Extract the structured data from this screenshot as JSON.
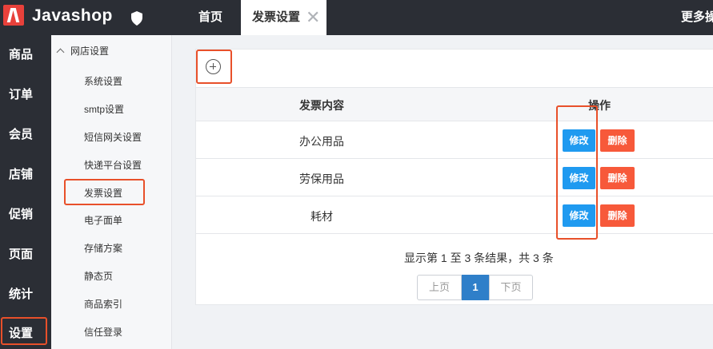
{
  "app": {
    "name": "Javashop"
  },
  "topbar": {
    "tabs": [
      {
        "label": "首页"
      },
      {
        "label": "发票设置",
        "close": "✕"
      }
    ],
    "more": "更多操"
  },
  "leftnav": {
    "items": [
      {
        "label": "商品"
      },
      {
        "label": "订单"
      },
      {
        "label": "会员"
      },
      {
        "label": "店铺"
      },
      {
        "label": "促销"
      },
      {
        "label": "页面"
      },
      {
        "label": "统计"
      },
      {
        "label": "设置"
      }
    ]
  },
  "submenu": {
    "group": "网店设置",
    "items": [
      {
        "label": "系统设置"
      },
      {
        "label": "smtp设置"
      },
      {
        "label": "短信网关设置"
      },
      {
        "label": "快递平台设置"
      },
      {
        "label": "发票设置"
      },
      {
        "label": "电子面单"
      },
      {
        "label": "存储方案"
      },
      {
        "label": "静态页"
      },
      {
        "label": "商品索引"
      },
      {
        "label": "信任登录"
      }
    ]
  },
  "table": {
    "headers": {
      "content": "发票内容",
      "action": "操作"
    },
    "rows": [
      {
        "name": "办公用品",
        "edit": "修改",
        "delete": "删除"
      },
      {
        "name": "劳保用品",
        "edit": "修改",
        "delete": "删除"
      },
      {
        "name": "耗材",
        "edit": "修改",
        "delete": "删除"
      }
    ]
  },
  "pagination": {
    "summary": "显示第 1 至 3 条结果，共 3 条",
    "prev": "上页",
    "current": "1",
    "next": "下页"
  },
  "colors": {
    "edit": "#1f9af0",
    "delete": "#f7593a",
    "highlight": "#e8502a",
    "brand": "#e8413b"
  }
}
